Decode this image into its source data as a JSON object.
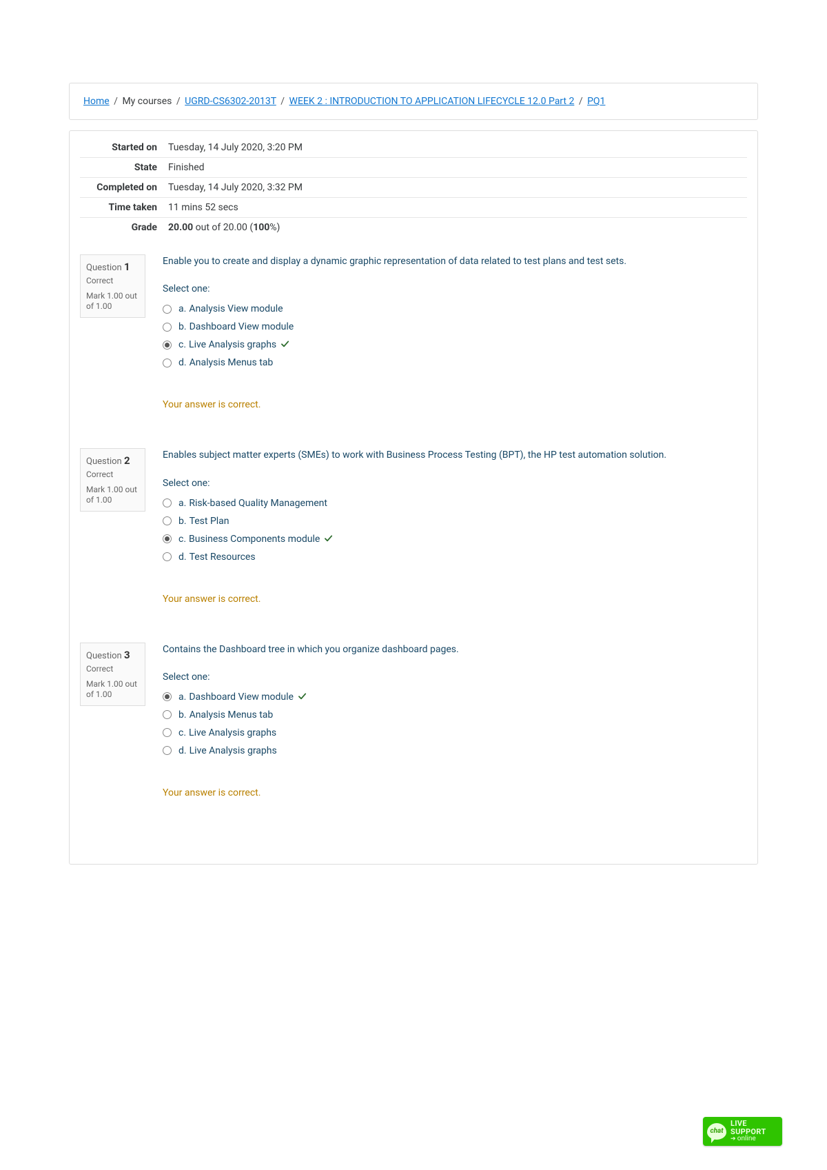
{
  "breadcrumb": {
    "home": "Home",
    "mycourses": "My courses",
    "course": "UGRD-CS6302-2013T",
    "section": "WEEK 2 : INTRODUCTION TO APPLICATION LIFECYCLE 12.0 Part 2",
    "item": "PQ1"
  },
  "summary": {
    "labels": {
      "started": "Started on",
      "state": "State",
      "completed": "Completed on",
      "timetaken": "Time taken",
      "grade": "Grade"
    },
    "started": "Tuesday, 14 July 2020, 3:20 PM",
    "state": "Finished",
    "completed": "Tuesday, 14 July 2020, 3:32 PM",
    "timetaken": "11 mins 52 secs",
    "grade_strong1": "20.00",
    "grade_mid": " out of 20.00 (",
    "grade_strong2": "100",
    "grade_after": "%)"
  },
  "qlabel": "Question",
  "selectone": "Select one:",
  "questions": [
    {
      "num": "1",
      "state": "Correct",
      "mark": "Mark 1.00 out of 1.00",
      "text": "Enable you to create and display a dynamic graphic representation of data related to test plans and test sets.",
      "options": [
        {
          "letter": "a.",
          "text": "Analysis View module",
          "selected": false,
          "correct": false
        },
        {
          "letter": "b.",
          "text": "Dashboard View module",
          "selected": false,
          "correct": false
        },
        {
          "letter": "c.",
          "text": "Live Analysis graphs",
          "selected": true,
          "correct": true
        },
        {
          "letter": "d.",
          "text": "Analysis Menus tab",
          "selected": false,
          "correct": false
        }
      ],
      "feedback": "Your answer is correct."
    },
    {
      "num": "2",
      "state": "Correct",
      "mark": "Mark 1.00 out of 1.00",
      "text": "Enables subject matter experts (SMEs) to work with Business Process Testing (BPT), the HP test automation solution.",
      "options": [
        {
          "letter": "a.",
          "text": "Risk-based Quality Management",
          "selected": false,
          "correct": false
        },
        {
          "letter": "b.",
          "text": "Test Plan",
          "selected": false,
          "correct": false
        },
        {
          "letter": "c.",
          "text": "Business Components module",
          "selected": true,
          "correct": true
        },
        {
          "letter": "d.",
          "text": "Test Resources",
          "selected": false,
          "correct": false
        }
      ],
      "feedback": "Your answer is correct."
    },
    {
      "num": "3",
      "state": "Correct",
      "mark": "Mark 1.00 out of 1.00",
      "text": "Contains the Dashboard tree in which you organize dashboard pages.",
      "options": [
        {
          "letter": "a.",
          "text": "Dashboard View module",
          "selected": true,
          "correct": true
        },
        {
          "letter": "b.",
          "text": "Analysis Menus tab",
          "selected": false,
          "correct": false
        },
        {
          "letter": "c.",
          "text": "Live Analysis graphs",
          "selected": false,
          "correct": false
        },
        {
          "letter": "d.",
          "text": "Live Analysis graphs",
          "selected": false,
          "correct": false
        }
      ],
      "feedback": "Your answer is correct."
    }
  ],
  "livechat": {
    "bubble": "chat",
    "l1": "LIVE",
    "l2": "SUPPORT",
    "l3": "online"
  }
}
